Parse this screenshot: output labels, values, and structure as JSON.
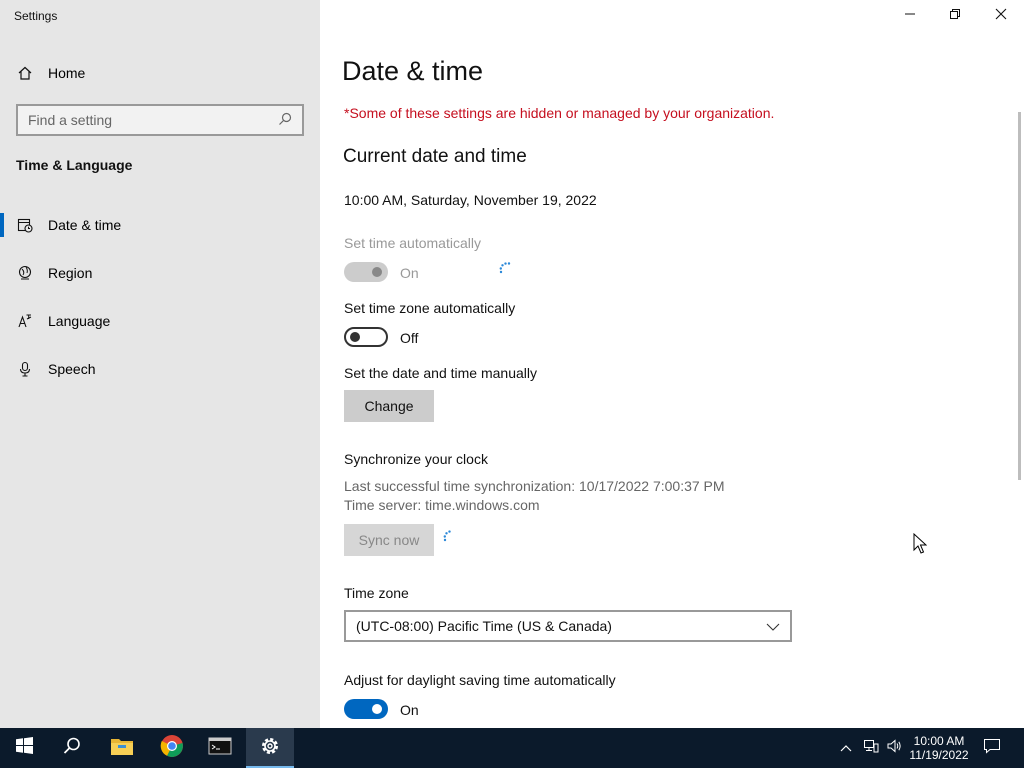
{
  "window": {
    "title": "Settings"
  },
  "sidebar": {
    "home_label": "Home",
    "search_placeholder": "Find a setting",
    "section_title": "Time & Language",
    "items": [
      {
        "label": "Date & time",
        "icon": "calendar-clock-icon",
        "active": true
      },
      {
        "label": "Region",
        "icon": "globe-icon"
      },
      {
        "label": "Language",
        "icon": "language-icon"
      },
      {
        "label": "Speech",
        "icon": "microphone-icon"
      }
    ]
  },
  "main": {
    "title": "Date & time",
    "policy_note": "*Some of these settings are hidden or managed by your organization.",
    "current_heading": "Current date and time",
    "current_datetime": "10:00 AM, Saturday, November 19, 2022",
    "set_time_auto": {
      "label": "Set time automatically",
      "state": "On",
      "enabled": false
    },
    "set_tz_auto": {
      "label": "Set time zone automatically",
      "state": "Off"
    },
    "manual": {
      "label": "Set the date and time manually",
      "button": "Change"
    },
    "sync": {
      "heading": "Synchronize your clock",
      "last_sync": "Last successful time synchronization: 10/17/2022 7:00:37 PM",
      "server": "Time server: time.windows.com",
      "button": "Sync now"
    },
    "timezone": {
      "label": "Time zone",
      "value": "(UTC-08:00) Pacific Time (US & Canada)"
    },
    "dst": {
      "label": "Adjust for daylight saving time automatically",
      "state": "On"
    }
  },
  "taskbar": {
    "time": "10:00 AM",
    "date": "11/19/2022",
    "apps": [
      "start-icon",
      "search-icon",
      "file-explorer-icon",
      "chrome-icon",
      "terminal-icon",
      "settings-icon"
    ]
  },
  "colors": {
    "accent": "#0067c0",
    "warning": "#c50f1f",
    "taskbar": "#0b1a2b"
  }
}
